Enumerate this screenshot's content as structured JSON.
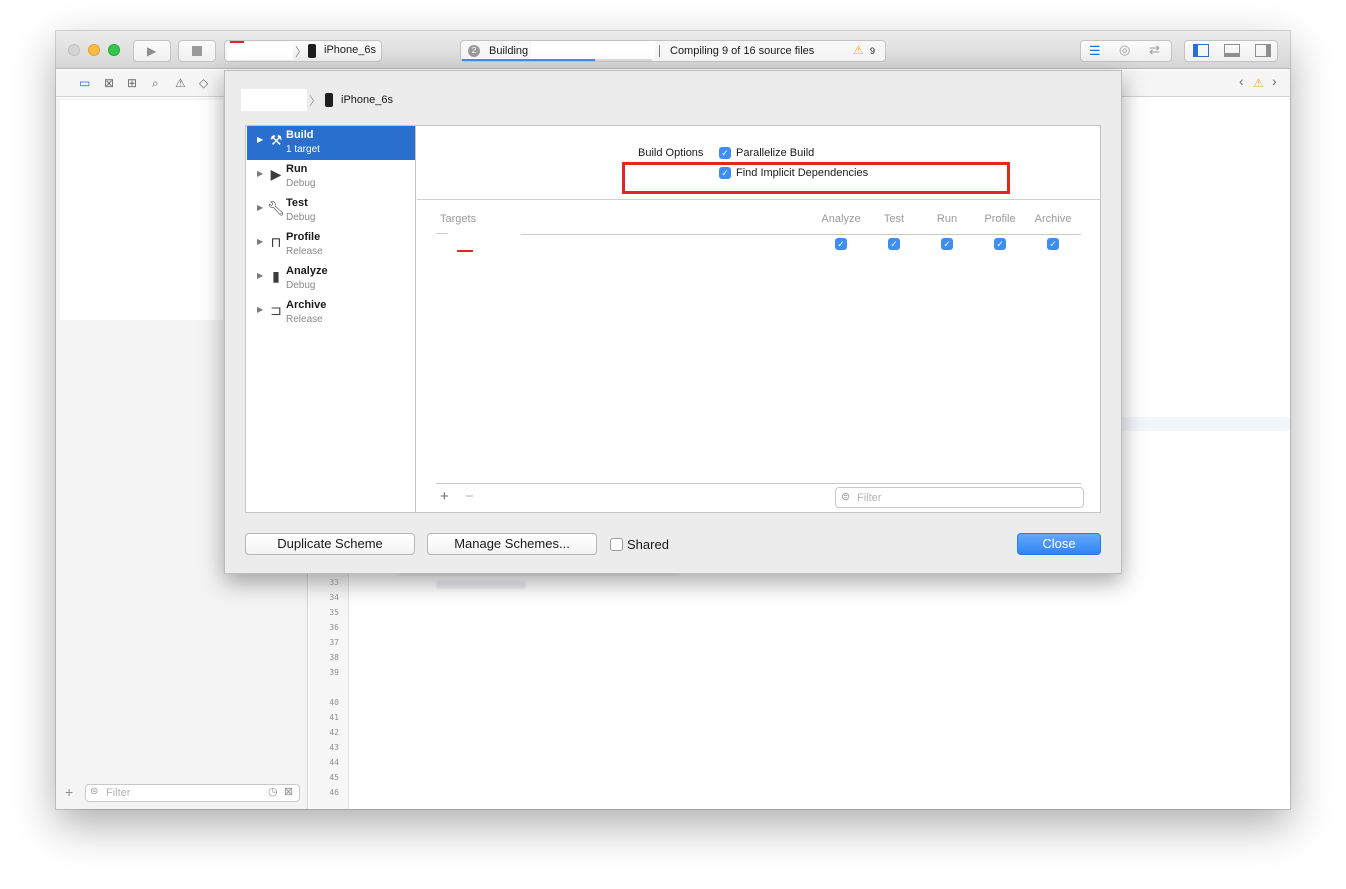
{
  "toolbar": {
    "scheme_device": "iPhone_6s",
    "activity_title": "Building",
    "activity_status": "Compiling 9 of 16 source files",
    "warning_count": "9",
    "activity_progress": 0.7
  },
  "editor": {
    "line_numbers": [
      "33",
      "34",
      "35",
      "36",
      "37",
      "38",
      "39",
      "40",
      "41",
      "42",
      "43",
      "44",
      "45",
      "46"
    ]
  },
  "left_pane": {
    "filter_placeholder": "Filter"
  },
  "sheet": {
    "breadcrumb_device": "iPhone_6s",
    "actions": [
      {
        "name": "Build",
        "sub": "1 target"
      },
      {
        "name": "Run",
        "sub": "Debug"
      },
      {
        "name": "Test",
        "sub": "Debug"
      },
      {
        "name": "Profile",
        "sub": "Release"
      },
      {
        "name": "Analyze",
        "sub": "Debug"
      },
      {
        "name": "Archive",
        "sub": "Release"
      }
    ],
    "build_options_label": "Build Options",
    "parallelize_label": "Parallelize Build",
    "parallelize_checked": true,
    "find_implicit_label": "Find Implicit Dependencies",
    "find_implicit_checked": true,
    "targets_header": "Targets",
    "columns": [
      "Analyze",
      "Test",
      "Run",
      "Profile",
      "Archive"
    ],
    "target_row_checks": [
      true,
      true,
      true,
      true,
      true
    ],
    "filter_placeholder": "Filter",
    "add_symbol": "+",
    "remove_symbol": "−",
    "duplicate_button": "Duplicate Scheme",
    "manage_button": "Manage Schemes...",
    "shared_label": "Shared",
    "shared_checked": false,
    "close_button": "Close",
    "highlight_color": "#e0281f"
  },
  "colors": {
    "accent": "#3d8ef0",
    "selection": "#2b6fce",
    "close_button": "#3b8cf5"
  }
}
